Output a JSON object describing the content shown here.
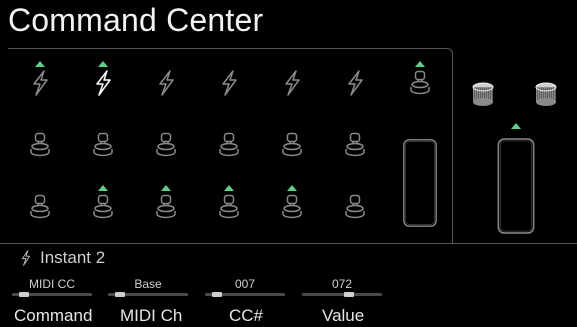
{
  "header": {
    "title": "Command Center"
  },
  "grid": {
    "rows": [
      [
        {
          "icon": "bolt-icon",
          "active": true,
          "selected": false
        },
        {
          "icon": "bolt-icon",
          "active": true,
          "selected": true
        },
        {
          "icon": "bolt-icon",
          "active": false,
          "selected": false
        },
        {
          "icon": "bolt-icon",
          "active": false,
          "selected": false
        },
        {
          "icon": "bolt-icon",
          "active": false,
          "selected": false
        },
        {
          "icon": "bolt-icon",
          "active": false,
          "selected": false
        },
        {
          "icon": "footswitch-icon",
          "active": true,
          "selected": false
        }
      ],
      [
        {
          "icon": "footswitch-icon",
          "active": false
        },
        {
          "icon": "footswitch-icon",
          "active": false
        },
        {
          "icon": "footswitch-icon",
          "active": false
        },
        {
          "icon": "footswitch-icon",
          "active": false
        },
        {
          "icon": "footswitch-icon",
          "active": false
        },
        {
          "icon": "footswitch-icon",
          "active": false
        }
      ],
      [
        {
          "icon": "footswitch-icon",
          "active": false
        },
        {
          "icon": "footswitch-icon",
          "active": true
        },
        {
          "icon": "footswitch-icon",
          "active": true
        },
        {
          "icon": "footswitch-icon",
          "active": true
        },
        {
          "icon": "footswitch-icon",
          "active": true
        },
        {
          "icon": "footswitch-icon",
          "active": false
        }
      ]
    ],
    "expression_pedals": [
      {
        "icon": "expression-pedal-icon",
        "active": false
      },
      {
        "icon": "expression-pedal-icon",
        "active": true
      }
    ],
    "knobs": [
      {
        "icon": "knob-icon"
      },
      {
        "icon": "knob-icon"
      }
    ]
  },
  "status": {
    "icon": "bolt-icon",
    "text": "Instant 2"
  },
  "params": [
    {
      "value": "MIDI CC",
      "label": "Command",
      "level": 0.1
    },
    {
      "value": "Base",
      "label": "MIDI Ch",
      "level": 0.1
    },
    {
      "value": "007",
      "label": "CC#",
      "level": 0.1
    },
    {
      "value": "072",
      "label": "Value",
      "level": 0.6
    }
  ],
  "colors": {
    "accent": "#5fcf8a",
    "background": "#000000",
    "icon": "#8a8a8a",
    "icon_selected": "#ffffff"
  }
}
